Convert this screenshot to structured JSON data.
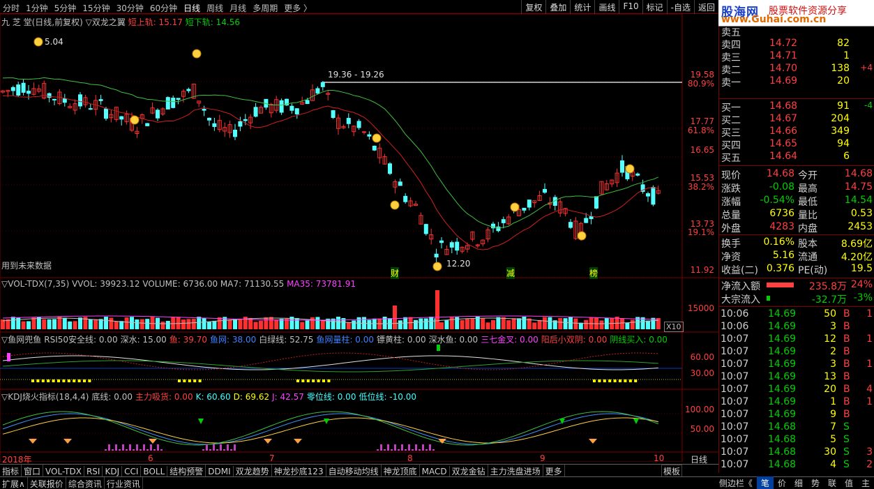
{
  "topbar": {
    "tabs": [
      "分时",
      "1分钟",
      "5分钟",
      "15分钟",
      "30分钟",
      "60分钟",
      "日线",
      "周线",
      "月线",
      "多周期",
      "更多 〉"
    ],
    "buttons": [
      "复权",
      "叠加",
      "统计",
      "画线",
      "F10",
      "标记",
      "-自选",
      "返回"
    ]
  },
  "logo": {
    "brand": "股海网",
    "slogan": "股票软件资源分享",
    "url": "www.Guhai.com.cn"
  },
  "main_legend": {
    "stock": "九 芝 堂(日线,前复权)",
    "indicator": "▽双龙之翼",
    "short_up": "短上轨: 15.17",
    "short_down": "短下轨: 14.56"
  },
  "main_axis": {
    "prices": [
      "19.58",
      "17.77",
      "16.65",
      "15.53",
      "13.73",
      "11.92"
    ],
    "pcts": [
      "80.9%",
      "61.8%",
      "38.2%",
      "19.1%"
    ]
  },
  "annotations": {
    "range_label": "19.36 - 19.26",
    "low_label": "12.20",
    "left_label": "5.04",
    "future_note": "用到未来数据",
    "event_labels": [
      "财",
      "减",
      "榜"
    ]
  },
  "vol_legend": {
    "name": "▽VOL-TDX(7,35)",
    "vvol": "VVOL: 39923.12",
    "volume": "VOLUME: 6736.00",
    "ma7": "MA7: 71130.55",
    "ma35": "MA35: 73781.91",
    "axis": "15000",
    "unit": "X10"
  },
  "fish_legend": {
    "name": "▽鱼网兜鱼",
    "items": [
      "RSI50安全线: 0.00",
      "深水: 15.00",
      "鱼: 39.70",
      "鱼网: 38.00",
      "白绿线: 52.75",
      "鱼网量柱: 0.00",
      "镖黄柱: 0.00",
      "深水鱼: 0.00",
      "三七金叉: 0.00",
      "阳后小双阴: 0.00",
      "阴线买入: 0.00"
    ],
    "axis": [
      "60.00",
      "30.00"
    ]
  },
  "kdj_legend": {
    "name": "▽KDJ烧火指标(18,4,4)",
    "items": [
      "底线: 0.00",
      "主力吸货: 0.00",
      "K: 60.60",
      "D: 69.62",
      "J: 42.57",
      "零位线: 0.00",
      "低位线: -10.00"
    ],
    "axis": [
      "100.00",
      "50.00"
    ]
  },
  "xaxis": {
    "labels": [
      "2018年",
      "6",
      "7",
      "8",
      "9",
      "10"
    ],
    "right": "日线"
  },
  "bottom_tabs": [
    "指标",
    "窗口",
    "VOL-TDX",
    "RSI",
    "KDJ",
    "CCI",
    "BOLL",
    "结构预警",
    "DDMI",
    "双龙趋势",
    "神龙抄底123",
    "自动移动均线",
    "神龙顶底",
    "MACD",
    "双龙金钻",
    "主力洗盘进场",
    "更多"
  ],
  "bottom_right": "模板",
  "status_bar": [
    "扩展∧",
    "关联报价",
    "综合资讯",
    "行业资讯"
  ],
  "status_right": [
    "侧边栏《",
    "笔",
    "价",
    "细",
    "势",
    "联",
    "值",
    "主"
  ],
  "order_book": {
    "asks": [
      {
        "label": "卖五",
        "price": "",
        "vol": "",
        "chg": ""
      },
      {
        "label": "卖四",
        "price": "14.72",
        "vol": "82",
        "chg": ""
      },
      {
        "label": "卖三",
        "price": "14.71",
        "vol": "1",
        "chg": ""
      },
      {
        "label": "卖二",
        "price": "14.70",
        "vol": "138",
        "chg": "+4"
      },
      {
        "label": "卖一",
        "price": "14.69",
        "vol": "20",
        "chg": ""
      }
    ],
    "bids": [
      {
        "label": "买一",
        "price": "14.68",
        "vol": "91",
        "chg": "-4"
      },
      {
        "label": "买二",
        "price": "14.67",
        "vol": "204",
        "chg": ""
      },
      {
        "label": "买三",
        "price": "14.66",
        "vol": "349",
        "chg": ""
      },
      {
        "label": "买四",
        "price": "14.65",
        "vol": "94",
        "chg": ""
      },
      {
        "label": "买五",
        "price": "14.64",
        "vol": "6",
        "chg": ""
      }
    ]
  },
  "stats": [
    [
      "现价",
      "14.68",
      "今开",
      "14.68"
    ],
    [
      "涨跌",
      "-0.08",
      "最高",
      "14.75"
    ],
    [
      "涨幅",
      "-0.54%",
      "最低",
      "14.54"
    ],
    [
      "总量",
      "6736",
      "量比",
      "0.53"
    ],
    [
      "外盘",
      "4283",
      "内盘",
      "2453"
    ]
  ],
  "stats2": [
    [
      "换手",
      "0.16%",
      "股本",
      "8.69亿"
    ],
    [
      "净资",
      "5.16",
      "流通",
      "4.20亿"
    ],
    [
      "收益(二)",
      "0.376",
      "PE(动)",
      "19.5"
    ]
  ],
  "flow": [
    {
      "label": "净流入额",
      "value": "235.8万",
      "pct": "24%",
      "ratio": 0.85
    },
    {
      "label": "大宗流入",
      "value": "-32.7万",
      "pct": "-3%",
      "ratio": 0.1
    }
  ],
  "ticks": [
    [
      "10:06",
      "14.69",
      "50",
      "B"
    ],
    [
      "10:06",
      "14.69",
      "3",
      "B"
    ],
    [
      "10:07",
      "14.69",
      "12",
      "B"
    ],
    [
      "10:07",
      "14.69",
      "2",
      "B"
    ],
    [
      "10:07",
      "14.69",
      "3",
      "B"
    ],
    [
      "10:07",
      "14.69",
      "13",
      "B"
    ],
    [
      "10:07",
      "14.69",
      "20",
      "B"
    ],
    [
      "10:07",
      "14.69",
      "1",
      "B"
    ],
    [
      "10:07",
      "14.69",
      "9",
      "B"
    ],
    [
      "10:07",
      "14.68",
      "7",
      "S"
    ],
    [
      "10:07",
      "14.68",
      "5",
      "S"
    ],
    [
      "10:07",
      "14.68",
      "30",
      "S"
    ],
    [
      "10:07",
      "14.68",
      "4",
      "S"
    ]
  ],
  "tick_extra": [
    "1",
    "",
    "1",
    "",
    "1",
    "",
    "4",
    "1",
    "",
    "",
    "",
    "3",
    "2"
  ]
}
